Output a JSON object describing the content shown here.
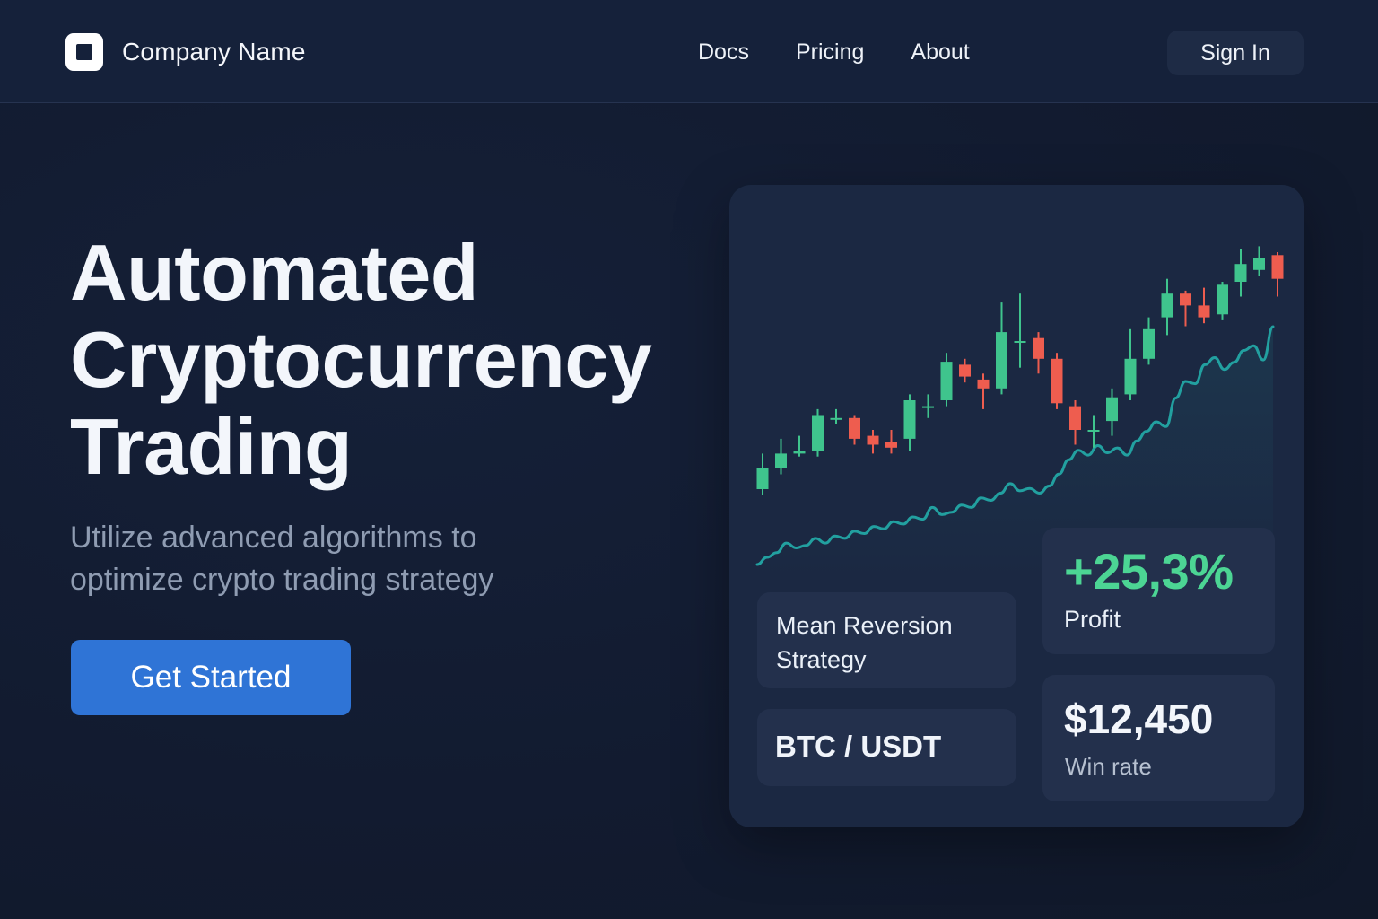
{
  "header": {
    "brand_name": "Company Name",
    "logo_icon": "square-logo-icon",
    "nav": [
      {
        "label": "Docs"
      },
      {
        "label": "Pricing"
      },
      {
        "label": "About"
      }
    ],
    "signin_label": "Sign In"
  },
  "hero": {
    "title_lines": [
      "Automated",
      "Cryptocurrency",
      "Trading"
    ],
    "subtitle_lines": [
      "Utilize advanced algorithms to",
      "optimize crypto trading strategy"
    ],
    "cta_label": "Get Started"
  },
  "card": {
    "strategy": "Mean Reversion Strategy",
    "pair": "BTC / USDT",
    "profit": {
      "value": "+25,3%",
      "label": "Profit"
    },
    "win": {
      "value": "$12,450",
      "label": "Win rate"
    }
  },
  "colors": {
    "background": "#121c31",
    "card": "#1b2842",
    "tile": "#23304c",
    "accent_blue": "#2f74d6",
    "candle_up": "#3fc48d",
    "candle_down": "#ee5d4f",
    "trend_line": "#22a0a0",
    "profit_green": "#4cd594"
  },
  "chart_data": {
    "type": "candlestick",
    "candles": [
      {
        "o": 10,
        "c": 17,
        "h": 22,
        "l": 8
      },
      {
        "o": 17,
        "c": 22,
        "h": 27,
        "l": 15
      },
      {
        "o": 22,
        "c": 23,
        "h": 28,
        "l": 21
      },
      {
        "o": 23,
        "c": 35,
        "h": 37,
        "l": 21
      },
      {
        "o": 34,
        "c": 34,
        "h": 37,
        "l": 32
      },
      {
        "o": 34,
        "c": 27,
        "h": 35,
        "l": 25
      },
      {
        "o": 28,
        "c": 25,
        "h": 30,
        "l": 22
      },
      {
        "o": 26,
        "c": 24,
        "h": 30,
        "l": 22
      },
      {
        "o": 27,
        "c": 40,
        "h": 42,
        "l": 23
      },
      {
        "o": 38,
        "c": 38,
        "h": 42,
        "l": 34
      },
      {
        "o": 40,
        "c": 53,
        "h": 56,
        "l": 38
      },
      {
        "o": 52,
        "c": 48,
        "h": 54,
        "l": 46
      },
      {
        "o": 47,
        "c": 44,
        "h": 49,
        "l": 37
      },
      {
        "o": 44,
        "c": 63,
        "h": 73,
        "l": 42
      },
      {
        "o": 60,
        "c": 60,
        "h": 76,
        "l": 51
      },
      {
        "o": 61,
        "c": 54,
        "h": 63,
        "l": 49
      },
      {
        "o": 54,
        "c": 39,
        "h": 56,
        "l": 37
      },
      {
        "o": 38,
        "c": 30,
        "h": 40,
        "l": 25
      },
      {
        "o": 30,
        "c": 30,
        "h": 35,
        "l": 24
      },
      {
        "o": 33,
        "c": 41,
        "h": 44,
        "l": 28
      },
      {
        "o": 42,
        "c": 54,
        "h": 64,
        "l": 40
      },
      {
        "o": 54,
        "c": 64,
        "h": 68,
        "l": 52
      },
      {
        "o": 68,
        "c": 76,
        "h": 81,
        "l": 62
      },
      {
        "o": 76,
        "c": 72,
        "h": 77,
        "l": 65
      },
      {
        "o": 72,
        "c": 68,
        "h": 78,
        "l": 66
      },
      {
        "o": 69,
        "c": 79,
        "h": 80,
        "l": 67
      },
      {
        "o": 80,
        "c": 86,
        "h": 91,
        "l": 75
      },
      {
        "o": 84,
        "c": 88,
        "h": 92,
        "l": 82
      },
      {
        "o": 89,
        "c": 81,
        "h": 90,
        "l": 75
      }
    ],
    "trend": [
      0,
      3,
      5,
      9,
      7,
      8,
      11,
      9,
      12,
      11,
      14,
      13,
      16,
      15,
      18,
      17,
      20,
      19,
      24,
      21,
      22,
      25,
      24,
      28,
      27,
      30,
      34,
      31,
      32,
      30,
      33,
      38,
      44,
      48,
      46,
      50,
      47,
      49,
      46,
      52,
      56,
      60,
      58,
      70,
      77,
      76,
      84,
      87,
      82,
      85,
      90,
      92,
      86,
      100
    ]
  }
}
